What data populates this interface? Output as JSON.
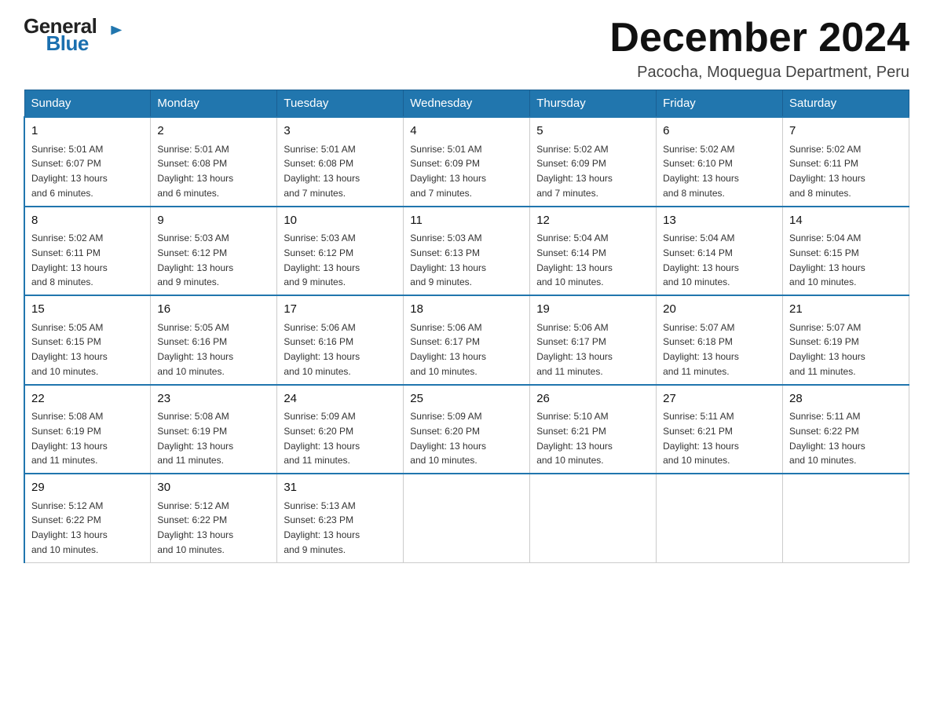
{
  "header": {
    "logo_text_general": "General",
    "logo_text_blue": "Blue",
    "title": "December 2024",
    "subtitle": "Pacocha, Moquegua Department, Peru"
  },
  "days_of_week": [
    "Sunday",
    "Monday",
    "Tuesday",
    "Wednesday",
    "Thursday",
    "Friday",
    "Saturday"
  ],
  "weeks": [
    [
      {
        "day": "1",
        "sunrise": "5:01 AM",
        "sunset": "6:07 PM",
        "daylight": "13 hours and 6 minutes."
      },
      {
        "day": "2",
        "sunrise": "5:01 AM",
        "sunset": "6:08 PM",
        "daylight": "13 hours and 6 minutes."
      },
      {
        "day": "3",
        "sunrise": "5:01 AM",
        "sunset": "6:08 PM",
        "daylight": "13 hours and 7 minutes."
      },
      {
        "day": "4",
        "sunrise": "5:01 AM",
        "sunset": "6:09 PM",
        "daylight": "13 hours and 7 minutes."
      },
      {
        "day": "5",
        "sunrise": "5:02 AM",
        "sunset": "6:09 PM",
        "daylight": "13 hours and 7 minutes."
      },
      {
        "day": "6",
        "sunrise": "5:02 AM",
        "sunset": "6:10 PM",
        "daylight": "13 hours and 8 minutes."
      },
      {
        "day": "7",
        "sunrise": "5:02 AM",
        "sunset": "6:11 PM",
        "daylight": "13 hours and 8 minutes."
      }
    ],
    [
      {
        "day": "8",
        "sunrise": "5:02 AM",
        "sunset": "6:11 PM",
        "daylight": "13 hours and 8 minutes."
      },
      {
        "day": "9",
        "sunrise": "5:03 AM",
        "sunset": "6:12 PM",
        "daylight": "13 hours and 9 minutes."
      },
      {
        "day": "10",
        "sunrise": "5:03 AM",
        "sunset": "6:12 PM",
        "daylight": "13 hours and 9 minutes."
      },
      {
        "day": "11",
        "sunrise": "5:03 AM",
        "sunset": "6:13 PM",
        "daylight": "13 hours and 9 minutes."
      },
      {
        "day": "12",
        "sunrise": "5:04 AM",
        "sunset": "6:14 PM",
        "daylight": "13 hours and 10 minutes."
      },
      {
        "day": "13",
        "sunrise": "5:04 AM",
        "sunset": "6:14 PM",
        "daylight": "13 hours and 10 minutes."
      },
      {
        "day": "14",
        "sunrise": "5:04 AM",
        "sunset": "6:15 PM",
        "daylight": "13 hours and 10 minutes."
      }
    ],
    [
      {
        "day": "15",
        "sunrise": "5:05 AM",
        "sunset": "6:15 PM",
        "daylight": "13 hours and 10 minutes."
      },
      {
        "day": "16",
        "sunrise": "5:05 AM",
        "sunset": "6:16 PM",
        "daylight": "13 hours and 10 minutes."
      },
      {
        "day": "17",
        "sunrise": "5:06 AM",
        "sunset": "6:16 PM",
        "daylight": "13 hours and 10 minutes."
      },
      {
        "day": "18",
        "sunrise": "5:06 AM",
        "sunset": "6:17 PM",
        "daylight": "13 hours and 10 minutes."
      },
      {
        "day": "19",
        "sunrise": "5:06 AM",
        "sunset": "6:17 PM",
        "daylight": "13 hours and 11 minutes."
      },
      {
        "day": "20",
        "sunrise": "5:07 AM",
        "sunset": "6:18 PM",
        "daylight": "13 hours and 11 minutes."
      },
      {
        "day": "21",
        "sunrise": "5:07 AM",
        "sunset": "6:19 PM",
        "daylight": "13 hours and 11 minutes."
      }
    ],
    [
      {
        "day": "22",
        "sunrise": "5:08 AM",
        "sunset": "6:19 PM",
        "daylight": "13 hours and 11 minutes."
      },
      {
        "day": "23",
        "sunrise": "5:08 AM",
        "sunset": "6:19 PM",
        "daylight": "13 hours and 11 minutes."
      },
      {
        "day": "24",
        "sunrise": "5:09 AM",
        "sunset": "6:20 PM",
        "daylight": "13 hours and 11 minutes."
      },
      {
        "day": "25",
        "sunrise": "5:09 AM",
        "sunset": "6:20 PM",
        "daylight": "13 hours and 10 minutes."
      },
      {
        "day": "26",
        "sunrise": "5:10 AM",
        "sunset": "6:21 PM",
        "daylight": "13 hours and 10 minutes."
      },
      {
        "day": "27",
        "sunrise": "5:11 AM",
        "sunset": "6:21 PM",
        "daylight": "13 hours and 10 minutes."
      },
      {
        "day": "28",
        "sunrise": "5:11 AM",
        "sunset": "6:22 PM",
        "daylight": "13 hours and 10 minutes."
      }
    ],
    [
      {
        "day": "29",
        "sunrise": "5:12 AM",
        "sunset": "6:22 PM",
        "daylight": "13 hours and 10 minutes."
      },
      {
        "day": "30",
        "sunrise": "5:12 AM",
        "sunset": "6:22 PM",
        "daylight": "13 hours and 10 minutes."
      },
      {
        "day": "31",
        "sunrise": "5:13 AM",
        "sunset": "6:23 PM",
        "daylight": "13 hours and 9 minutes."
      },
      null,
      null,
      null,
      null
    ]
  ],
  "labels": {
    "sunrise": "Sunrise:",
    "sunset": "Sunset:",
    "daylight": "Daylight:"
  }
}
